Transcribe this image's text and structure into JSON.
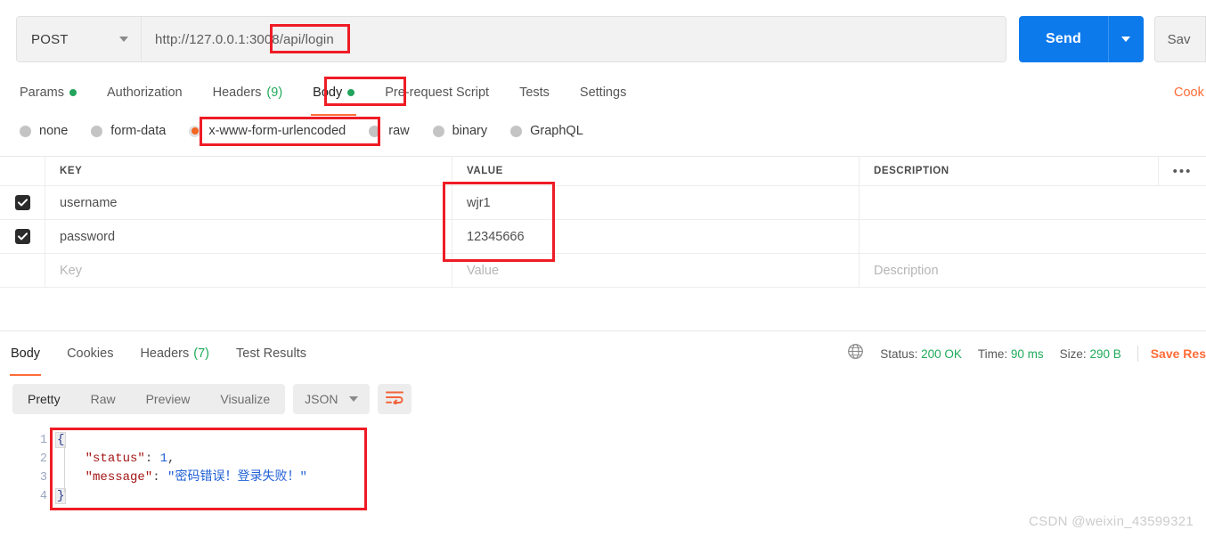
{
  "request": {
    "method": "POST",
    "method_icon": "chevron-down-icon",
    "url": "http://127.0.0.1:3008/api/login",
    "send_label": "Send",
    "send_caret_icon": "chevron-down-icon",
    "save_label": "Sav",
    "tabs": [
      {
        "label": "Params",
        "badge": "dot",
        "active": false
      },
      {
        "label": "Authorization",
        "badge": "",
        "active": false
      },
      {
        "label": "Headers",
        "badge": "(9)",
        "active": false
      },
      {
        "label": "Body",
        "badge": "dot",
        "active": true
      },
      {
        "label": "Pre-request Script",
        "badge": "",
        "active": false
      },
      {
        "label": "Tests",
        "badge": "",
        "active": false
      },
      {
        "label": "Settings",
        "badge": "",
        "active": false
      }
    ],
    "cookies_link": "Cook",
    "body_types": [
      {
        "label": "none",
        "selected": false
      },
      {
        "label": "form-data",
        "selected": false
      },
      {
        "label": "x-www-form-urlencoded",
        "selected": true
      },
      {
        "label": "raw",
        "selected": false
      },
      {
        "label": "binary",
        "selected": false
      },
      {
        "label": "GraphQL",
        "selected": false
      }
    ],
    "table": {
      "headers": {
        "key": "KEY",
        "value": "VALUE",
        "description": "DESCRIPTION"
      },
      "more_icon": "ellipsis-icon",
      "rows": [
        {
          "checked": true,
          "key": "username",
          "value": "wjr1",
          "description": ""
        },
        {
          "checked": true,
          "key": "password",
          "value": "12345666",
          "description": ""
        }
      ],
      "placeholder_row": {
        "key": "Key",
        "value": "Value",
        "description": "Description"
      }
    }
  },
  "response": {
    "tabs": [
      {
        "label": "Body",
        "badge": "",
        "active": true
      },
      {
        "label": "Cookies",
        "badge": "",
        "active": false
      },
      {
        "label": "Headers",
        "badge": "(7)",
        "active": false
      },
      {
        "label": "Test Results",
        "badge": "",
        "active": false
      }
    ],
    "globe_icon": "globe-icon",
    "meta": {
      "status_label": "Status:",
      "status_value": "200 OK",
      "time_label": "Time:",
      "time_value": "90 ms",
      "size_label": "Size:",
      "size_value": "290 B"
    },
    "save_response_label": "Save Res",
    "format_tabs": [
      {
        "label": "Pretty",
        "active": true
      },
      {
        "label": "Raw",
        "active": false
      },
      {
        "label": "Preview",
        "active": false
      },
      {
        "label": "Visualize",
        "active": false
      }
    ],
    "format_select": "JSON",
    "format_select_icon": "chevron-down-icon",
    "wrap_icon": "word-wrap-icon",
    "code": {
      "line_numbers": [
        "1",
        "2",
        "3",
        "4"
      ],
      "lines": [
        {
          "open_brace": "{"
        },
        {
          "key": "\"status\"",
          "colon": ": ",
          "num": "1",
          "comma": ","
        },
        {
          "key": "\"message\"",
          "colon": ": ",
          "str": "\"密码错误！登录失败！\""
        },
        {
          "close_brace": "}"
        }
      ]
    }
  },
  "annotations": {
    "colors": {
      "box": "#ee1c25",
      "accent": "#ff6c37",
      "send": "#0d7aec",
      "green": "#1faa5a"
    }
  },
  "watermark": "CSDN @weixin_43599321"
}
